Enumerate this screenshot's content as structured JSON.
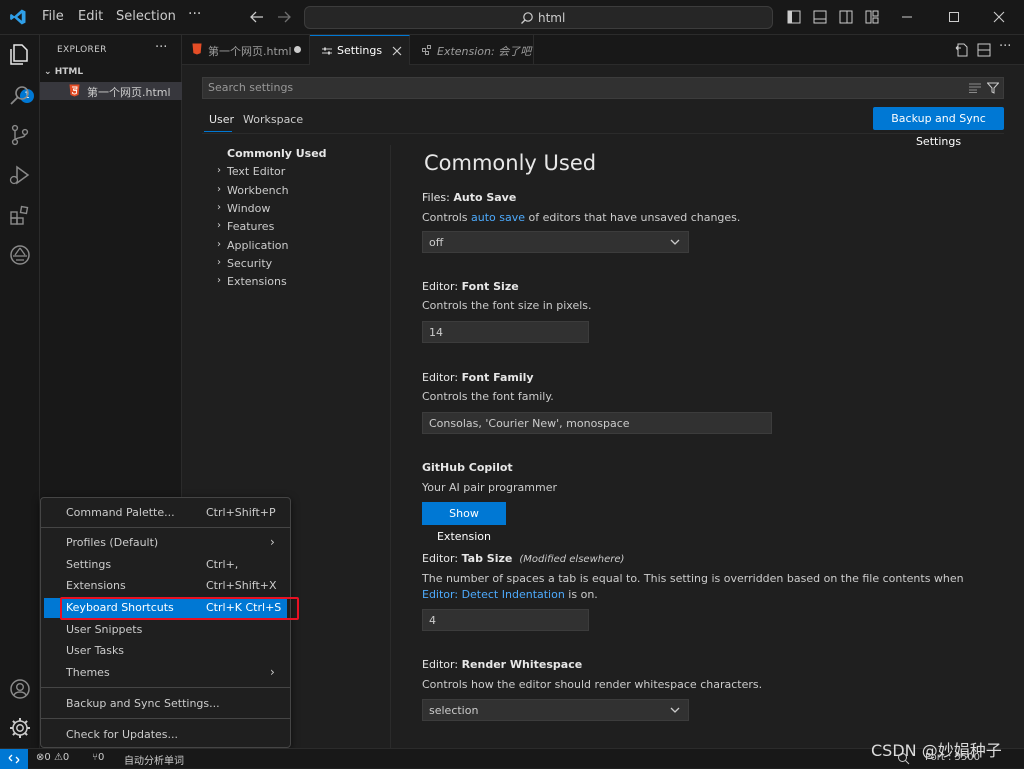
{
  "titlebar": {
    "menu": [
      "File",
      "Edit",
      "Selection"
    ],
    "more": "···",
    "search_text": "html"
  },
  "explorer": {
    "title": "EXPLORER",
    "dots": "···",
    "folder": "HTML",
    "file": "第一个网页.html"
  },
  "tabs": [
    {
      "label": "第一个网页.html",
      "modified": true
    },
    {
      "label": "Settings",
      "active": true
    },
    {
      "label": "Extension: 会了吧",
      "preview": true
    }
  ],
  "settings": {
    "search_placeholder": "Search settings",
    "scope_tabs": [
      "User",
      "Workspace"
    ],
    "sync_button": "Backup and Sync Settings",
    "toc": [
      "Commonly Used",
      "Text Editor",
      "Workbench",
      "Window",
      "Features",
      "Application",
      "Security",
      "Extensions"
    ],
    "section_title": "Commonly Used",
    "items": {
      "auto_save": {
        "category": "Files: ",
        "name": "Auto Save",
        "desc_pre": "Controls ",
        "desc_link": "auto save",
        "desc_post": " of editors that have unsaved changes.",
        "value": "off"
      },
      "font_size": {
        "category": "Editor: ",
        "name": "Font Size",
        "desc": "Controls the font size in pixels.",
        "value": "14"
      },
      "font_family": {
        "category": "Editor: ",
        "name": "Font Family",
        "desc": "Controls the font family.",
        "value": "Consolas, 'Courier New', monospace"
      },
      "copilot": {
        "name": "GitHub Copilot",
        "desc": "Your AI pair programmer",
        "button": "Show Extension"
      },
      "tab_size": {
        "category": "Editor: ",
        "name": "Tab Size",
        "modified": "(Modified elsewhere)",
        "desc_pre": "The number of spaces a tab is equal to. This setting is overridden based on the file contents when ",
        "desc_link1": "Editor: Detect",
        "desc_link2": "Indentation",
        "desc_post": " is on.",
        "value": "4"
      },
      "render_ws": {
        "category": "Editor: ",
        "name": "Render Whitespace",
        "desc": "Controls how the editor should render whitespace characters.",
        "value": "selection"
      }
    }
  },
  "menu": {
    "items": [
      {
        "label": "Command Palette...",
        "key": "Ctrl+Shift+P"
      },
      {
        "label": "Profiles (Default)",
        "submenu": "›"
      },
      {
        "label": "Settings",
        "key": "Ctrl+,"
      },
      {
        "label": "Extensions",
        "key": "Ctrl+Shift+X"
      },
      {
        "label": "Keyboard Shortcuts",
        "key": "Ctrl+K Ctrl+S",
        "selected": true
      },
      {
        "label": "User Snippets"
      },
      {
        "label": "User Tasks"
      },
      {
        "label": "Themes",
        "submenu": "›"
      },
      {
        "label": "Backup and Sync Settings..."
      },
      {
        "label": "Check for Updates..."
      }
    ]
  },
  "statusbar": {
    "errors": "0",
    "warnings": "0",
    "ports": "0",
    "auto_analyze": "自动分析单词",
    "port": "Port : 5500"
  },
  "watermark": "CSDN @妙娟种子",
  "colors": {
    "accent": "#0078d4",
    "link": "#4daafc",
    "highlight": "#e81123"
  }
}
